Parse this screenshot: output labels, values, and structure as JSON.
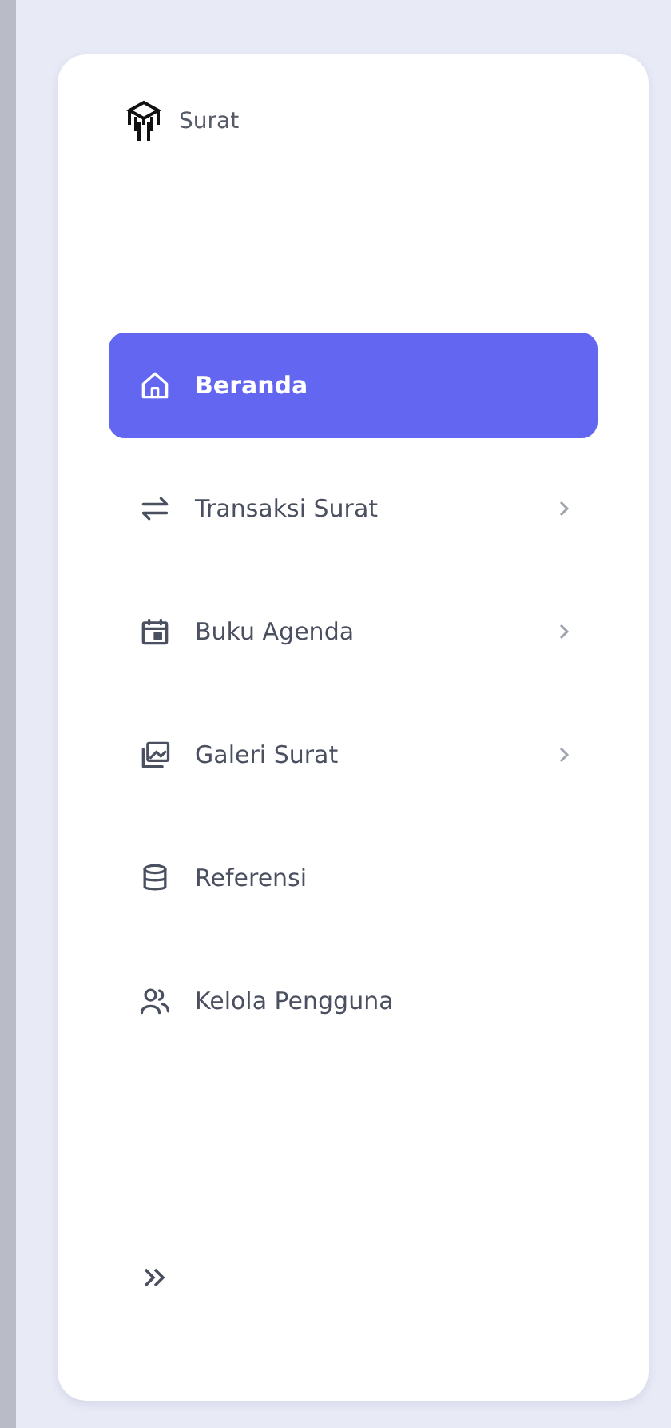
{
  "brand": {
    "name": "Surat"
  },
  "menu": [
    {
      "label": "Beranda",
      "selected": true,
      "submenu": false
    },
    {
      "label": "Transaksi Surat",
      "selected": false,
      "submenu": true
    },
    {
      "label": "Buku Agenda",
      "selected": false,
      "submenu": true
    },
    {
      "label": "Galeri Surat",
      "selected": false,
      "submenu": true
    },
    {
      "label": "Referensi",
      "selected": false,
      "submenu": false
    },
    {
      "label": "Kelola Pengguna",
      "selected": false,
      "submenu": false
    }
  ]
}
